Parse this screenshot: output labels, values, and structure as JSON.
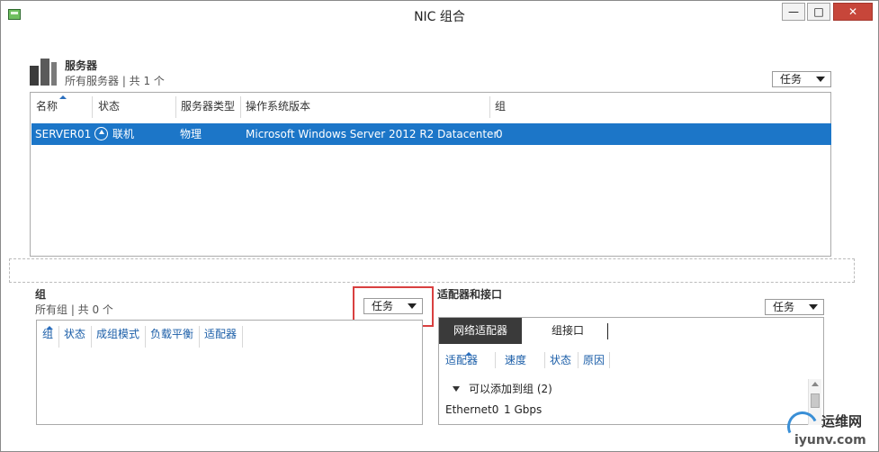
{
  "window": {
    "title": "NIC 组合",
    "minimize_glyph": "—",
    "maximize_glyph": "□",
    "close_glyph": "✕"
  },
  "servers": {
    "title": "服务器",
    "subtitle": "所有服务器 | 共 1 个",
    "tasks_label": "任务",
    "columns": [
      "名称",
      "状态",
      "服务器类型",
      "操作系统版本",
      "组"
    ],
    "rows": [
      {
        "name": "SERVER01",
        "status": "联机",
        "type": "物理",
        "os": "Microsoft Windows Server 2012 R2 Datacenter",
        "teams": "0"
      }
    ]
  },
  "teams": {
    "title": "组",
    "subtitle": "所有组 | 共 0 个",
    "tasks_label": "任务",
    "columns": [
      "组",
      "状态",
      "成组模式",
      "负载平衡",
      "适配器"
    ]
  },
  "adapters": {
    "title": "适配器和接口",
    "tasks_label": "任务",
    "tabs": [
      "网络适配器",
      "组接口"
    ],
    "active_tab": 0,
    "columns": [
      "适配器",
      "速度",
      "状态",
      "原因"
    ],
    "group_label": "可以添加到组 (2)",
    "rows": [
      {
        "adapter": "Ethernet0",
        "speed": "1 Gbps"
      }
    ]
  },
  "watermark": {
    "top": "运维网",
    "bottom": "iyunv.com"
  },
  "colors": {
    "selection": "#1c76c8",
    "header_link": "#1b5ea8",
    "highlight": "#d94040",
    "active_tab": "#3a3a3a"
  }
}
